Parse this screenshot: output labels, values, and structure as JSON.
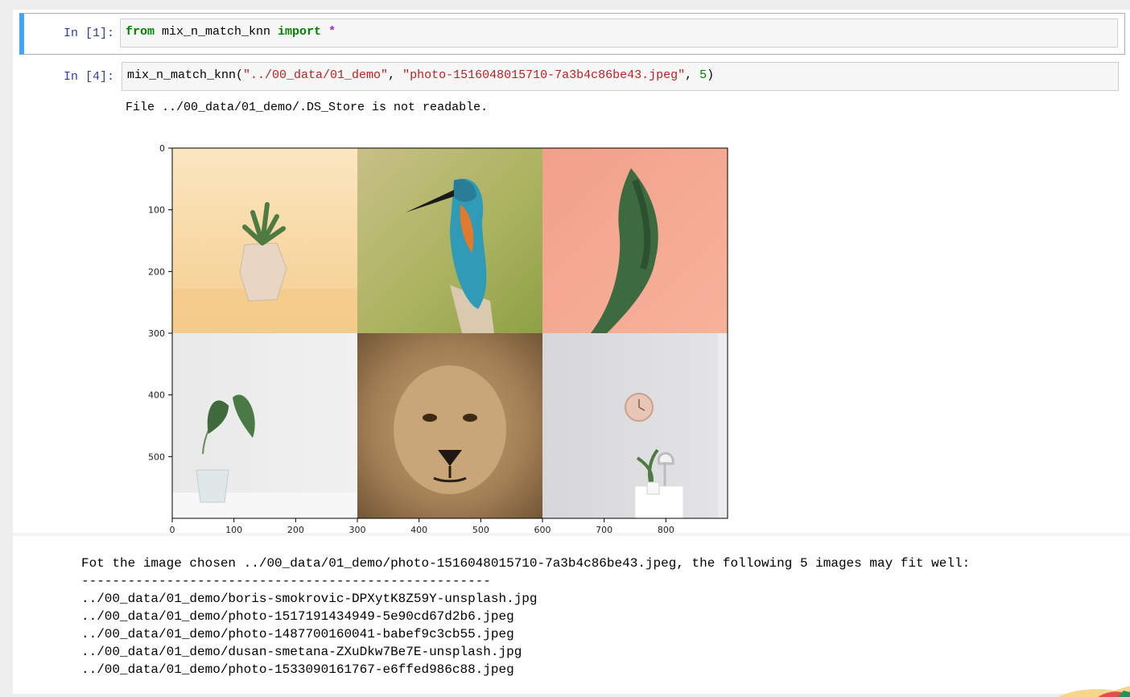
{
  "cells": [
    {
      "prompt": "In [1]:",
      "code": {
        "kw1": "from",
        "module": " mix_n_match_knn ",
        "kw2": "import",
        "op": " *"
      }
    },
    {
      "prompt": "In [4]:",
      "code": {
        "func": "mix_n_match_knn(",
        "arg1": "\"../00_data/01_demo\"",
        "sep1": ", ",
        "arg2": "\"photo-1516048015710-7a3b4c86be43.jpeg\"",
        "sep2": ", ",
        "arg3": "5",
        "close": ")"
      },
      "stderr": "File ../00_data/01_demo/.DS_Store is not readable."
    }
  ],
  "plot": {
    "images": [
      {
        "name": "succulent-in-pot",
        "bg": "#f6dba8"
      },
      {
        "name": "kingfisher-bird",
        "bg": "#b5b86c"
      },
      {
        "name": "pine-branch",
        "bg": "#f4a48a"
      },
      {
        "name": "leaves-in-vase",
        "bg": "#ececec"
      },
      {
        "name": "lion-face",
        "bg": "#b89468"
      },
      {
        "name": "wall-clock-room",
        "bg": "#dcdcde"
      }
    ]
  },
  "chart_data": {
    "type": "image",
    "xlim": [
      0,
      900
    ],
    "ylim": [
      600,
      0
    ],
    "xticks": [
      "0",
      "100",
      "200",
      "300",
      "400",
      "500",
      "600",
      "700",
      "800"
    ],
    "yticks": [
      "0",
      "100",
      "200",
      "300",
      "400",
      "500"
    ]
  },
  "result": {
    "header": "Fot the image chosen ../00_data/01_demo/photo-1516048015710-7a3b4c86be43.jpeg, the following 5 images may fit well:",
    "separator": "-----------------------------------------------------",
    "files": [
      "../00_data/01_demo/boris-smokrovic-DPXytK8Z59Y-unsplash.jpg",
      "../00_data/01_demo/photo-1517191434949-5e90cd67d2b6.jpeg",
      "../00_data/01_demo/photo-1487700160041-babef9c3cb55.jpeg",
      "../00_data/01_demo/dusan-smetana-ZXuDkw7Be7E-unsplash.jpg",
      "../00_data/01_demo/photo-1533090161767-e6ffed986c88.jpeg"
    ]
  }
}
